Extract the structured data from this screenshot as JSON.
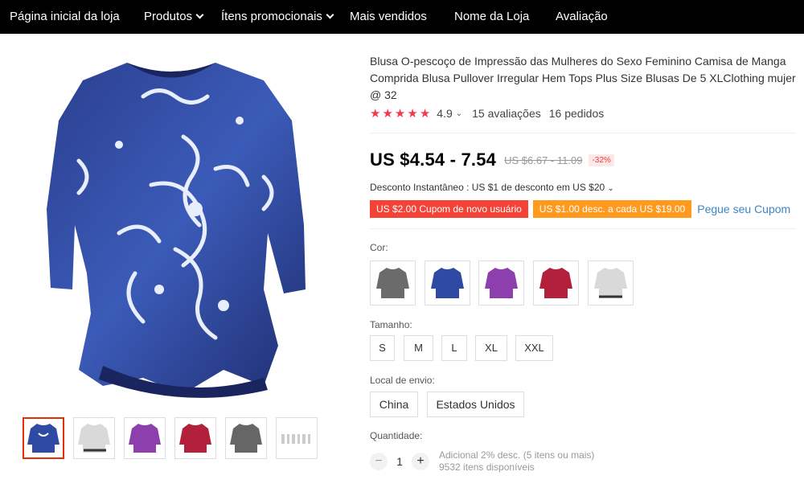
{
  "nav": {
    "items": [
      {
        "label": "Página inicial da loja",
        "dropdown": false
      },
      {
        "label": "Produtos",
        "dropdown": true
      },
      {
        "label": "Ítens promocionais",
        "dropdown": true
      },
      {
        "label": "Mais vendidos",
        "dropdown": false
      },
      {
        "label": "Nome da Loja",
        "dropdown": false
      },
      {
        "label": "Avaliação",
        "dropdown": false
      }
    ]
  },
  "product": {
    "title": "Blusa O-pescoço de Impressão das Mulheres do Sexo Feminino Camisa de Manga Comprida Blusa Pullover Irregular Hem Tops Plus Size Blusas De 5 XLClothing mujer @ 32",
    "rating": "4.9",
    "rating_stars": 5,
    "reviews": "15 avaliações",
    "orders": "16 pedidos",
    "price": "US $4.54 - 7.54",
    "old_price": "US $6.67 - 11.09",
    "discount": "-32%",
    "instant_discount": "Desconto Instantâneo : US $1 de desconto em US $20",
    "coupons": {
      "new_user": "US $2.00 Cupom de novo usuário",
      "per_purchase": "US $1.00 desc. a cada US $19.00",
      "link": "Pegue seu Cupom"
    },
    "color_label": "Cor:",
    "colors": [
      "gray",
      "blue",
      "purple",
      "red",
      "white"
    ],
    "size_label": "Tamanho:",
    "sizes": [
      "S",
      "M",
      "L",
      "XL",
      "XXL"
    ],
    "ship_label": "Local de envio:",
    "ship_from": [
      "China",
      "Estados Unidos"
    ],
    "quantity_label": "Quantidade:",
    "quantity": "1",
    "qty_extra": "Adicional 2% desc. (5 itens ou mais)",
    "qty_available": "9532 itens disponíveis"
  },
  "thumbnails": [
    "blue",
    "white",
    "purple",
    "red",
    "gray",
    "size-chart"
  ],
  "colors": {
    "nav_bg": "#000000",
    "star": "#f5384a",
    "price": "#000000",
    "coupon_red": "#f44336",
    "coupon_orange": "#ff9a1f",
    "link": "#3a86c8",
    "active_thumb_border": "#e62e04"
  }
}
